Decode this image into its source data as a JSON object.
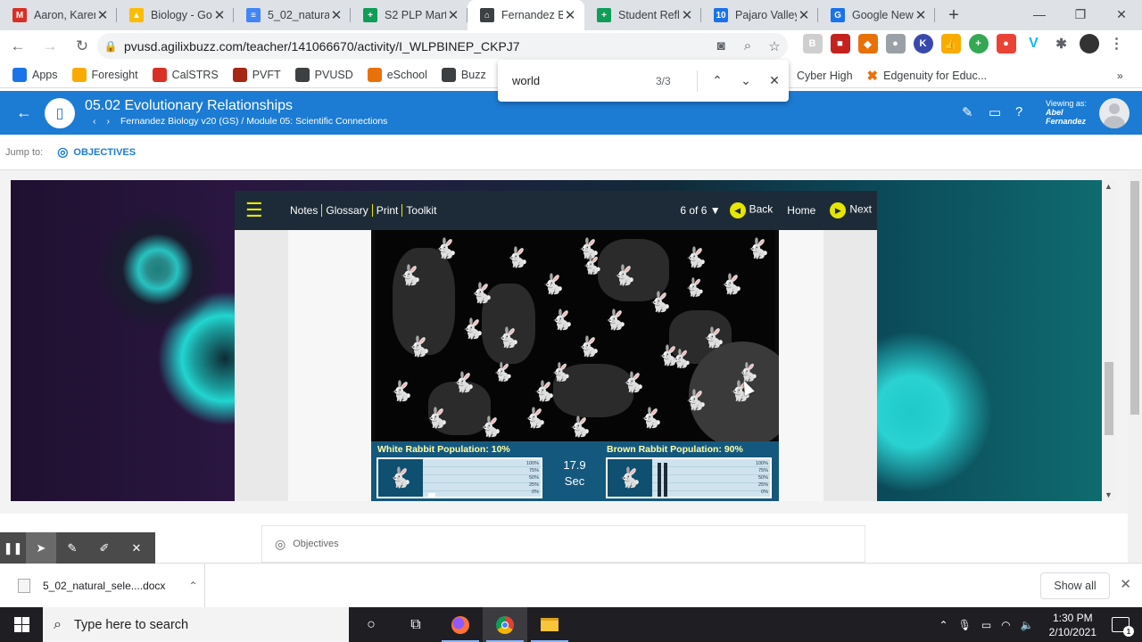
{
  "browser": {
    "tabs": [
      {
        "title": "Aaron, Karen",
        "favicon": "gmail-icon",
        "color": "#d93025",
        "glyph": "M"
      },
      {
        "title": "Biology - Go",
        "favicon": "drive-icon",
        "color": "#fbbc04",
        "glyph": "▲"
      },
      {
        "title": "5_02_natural",
        "favicon": "docs-icon",
        "color": "#4285f4",
        "glyph": "≡"
      },
      {
        "title": "S2 PLP Mart",
        "favicon": "sheets-icon",
        "color": "#0f9d58",
        "glyph": "+"
      },
      {
        "title": "Fernandez B",
        "favicon": "buzz-icon",
        "color": "#3c4043",
        "glyph": "⌂",
        "active": true
      },
      {
        "title": "Student Refl",
        "favicon": "sheets-icon",
        "color": "#0f9d58",
        "glyph": "+"
      },
      {
        "title": "Pajaro Valley",
        "favicon": "calendar-icon",
        "color": "#1a73e8",
        "glyph": "10"
      },
      {
        "title": "Google New",
        "favicon": "classroom-icon",
        "color": "#1a73e8",
        "glyph": "G"
      }
    ],
    "url": "pvusd.agilixbuzz.com/teacher/141066670/activity/I_WLPBINEP_CKPJ7",
    "bookmarks": [
      {
        "label": "Apps",
        "color": "#1a73e8"
      },
      {
        "label": "Foresight",
        "color": "#f9ab00"
      },
      {
        "label": "CalSTRS",
        "color": "#d93025"
      },
      {
        "label": "PVFT",
        "color": "#a52714"
      },
      {
        "label": "PVUSD",
        "color": "#3c4043"
      },
      {
        "label": "eSchool",
        "color": "#e8710a"
      },
      {
        "label": "Buzz",
        "color": "#3c4043"
      }
    ],
    "bookmarks_right": [
      {
        "label": "Cyber High"
      },
      {
        "label": "Edgenuity for Educ...",
        "color": "#e8710a"
      }
    ],
    "find": {
      "query": "world",
      "count": "3/3"
    }
  },
  "header": {
    "title": "05.02 Evolutionary Relationships",
    "breadcrumb": "Fernandez Biology v20 (GS) / Module 05: Scientific Connections",
    "viewing_as_label": "Viewing as:",
    "viewing_as_name1": "Abel",
    "viewing_as_name2": "Fernandez"
  },
  "jump": {
    "label": "Jump to:",
    "objectives": "OBJECTIVES"
  },
  "player": {
    "links": [
      "Notes",
      "Glossary",
      "Print",
      "Toolkit"
    ],
    "page": "6 of 6 ▼",
    "back": "Back",
    "home": "Home",
    "next": "Next",
    "accent": "#e6e600"
  },
  "sim": {
    "white_label": "White Rabbit Population:",
    "white_value": "10%",
    "white_fraction": 0.1,
    "brown_label": "Brown Rabbit Population:",
    "brown_value": "90%",
    "brown_fraction": 0.9,
    "timer_value": "17.9",
    "timer_unit": "Sec",
    "ticks": [
      "100%",
      "75%",
      "50%",
      "25%",
      "0%"
    ]
  },
  "objectives_card": "Objectives",
  "download": {
    "file": "5_02_natural_sele....docx",
    "show_all": "Show all"
  },
  "taskbar": {
    "search": "Type here to search",
    "time": "1:30 PM",
    "date": "2/10/2021",
    "notifications": "1"
  }
}
